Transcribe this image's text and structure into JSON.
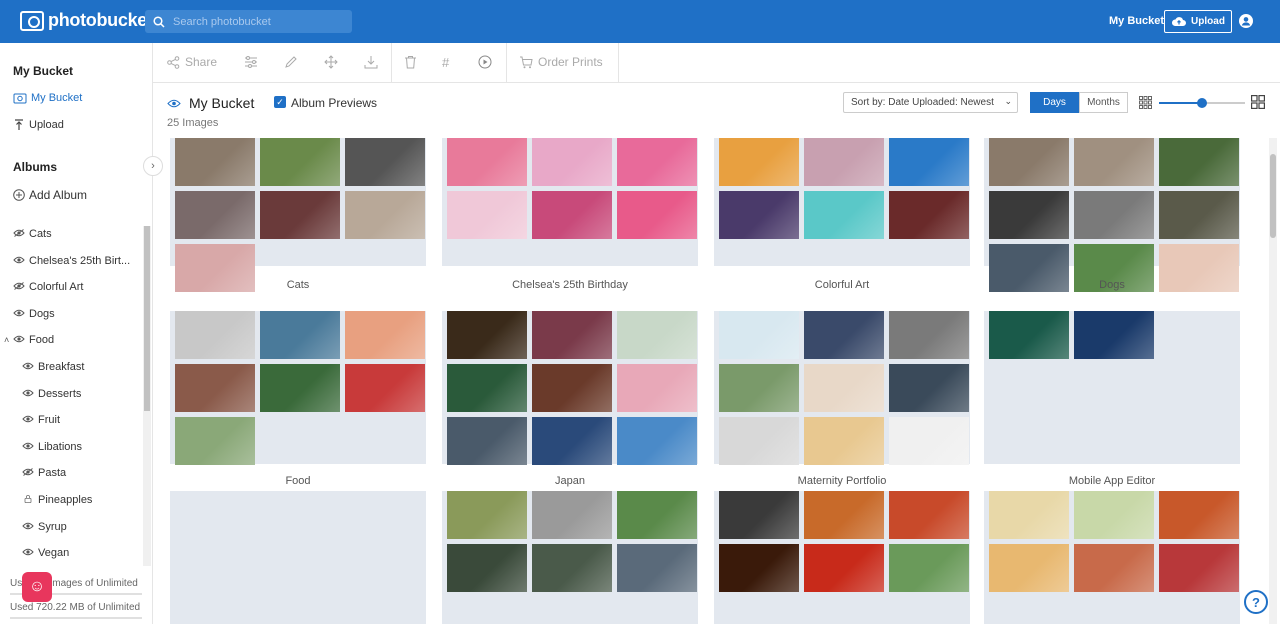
{
  "app": {
    "brand": "photobucket",
    "accent": "#1f70c6"
  },
  "topbar": {
    "search_placeholder": "Search photobucket",
    "my_bucket": "My Bucket",
    "upload": "Upload"
  },
  "sidebar": {
    "section_title": "My Bucket",
    "my_bucket": "My Bucket",
    "upload": "Upload",
    "albums_title": "Albums",
    "add_album": "Add Album",
    "albums": [
      {
        "label": "Cats",
        "icon": "eye-off-icon"
      },
      {
        "label": "Chelsea's 25th Birt...",
        "icon": "eye-icon"
      },
      {
        "label": "Colorful Art",
        "icon": "eye-off-icon"
      },
      {
        "label": "Dogs",
        "icon": "eye-icon"
      },
      {
        "label": "Food",
        "icon": "eye-icon"
      }
    ],
    "subalbums": [
      {
        "label": "Breakfast",
        "icon": "eye-icon"
      },
      {
        "label": "Desserts",
        "icon": "eye-icon"
      },
      {
        "label": "Fruit",
        "icon": "eye-icon"
      },
      {
        "label": "Libations",
        "icon": "eye-icon"
      },
      {
        "label": "Pasta",
        "icon": "eye-off-icon"
      },
      {
        "label": "Pineapples",
        "icon": "lock-icon"
      },
      {
        "label": "Syrup",
        "icon": "eye-icon"
      },
      {
        "label": "Vegan",
        "icon": "eye-icon"
      }
    ],
    "usage_images": "Used 25 images of Unlimited",
    "usage_storage": "Used 720.22 MB of Unlimited"
  },
  "toolbar": {
    "share": "Share",
    "order_prints": "Order Prints"
  },
  "header": {
    "title": "My Bucket",
    "album_previews": "Album Previews",
    "album_previews_checked": true,
    "image_count": "25 Images",
    "sort": "Sort by: Date Uploaded: Newest",
    "days": "Days",
    "months": "Months",
    "zoom_level": 0.5
  },
  "albums": [
    {
      "name": "Cats",
      "colors": [
        "#8a7a6a",
        "#6a8a4a",
        "#555555",
        "#7a6a6a",
        "#6a3a3a",
        "#b8a898",
        "#d8a8a8"
      ]
    },
    {
      "name": "Chelsea's 25th Birthday",
      "colors": [
        "#e87a9a",
        "#e8a8c8",
        "#e86a9a",
        "#f0c8d8",
        "#c84a7a",
        "#e85a8a"
      ]
    },
    {
      "name": "Colorful Art",
      "colors": [
        "#e8a040",
        "#c8a0b0",
        "#2a7ac8",
        "#4a3a6a",
        "#5ac8c8",
        "#6a2a2a"
      ]
    },
    {
      "name": "Dogs",
      "colors": [
        "#8a7a6a",
        "#a09080",
        "#4a6a3a",
        "#3a3a3a",
        "#7a7a7a",
        "#5a5a4a",
        "#4a5a6a",
        "#5a8a4a",
        "#e8c8b8"
      ]
    },
    {
      "name": "Food",
      "colors": [
        "#c8c8c8",
        "#4a7a9a",
        "#e8a080",
        "#8a5a4a",
        "#3a6a3a",
        "#c83a3a",
        "#8aa878"
      ]
    },
    {
      "name": "Japan",
      "colors": [
        "#3a2a1a",
        "#7a3a4a",
        "#c8d8c8",
        "#2a5a3a",
        "#6a3a2a",
        "#e8a8b8",
        "#4a5a6a",
        "#2a4a7a",
        "#4a8ac8"
      ]
    },
    {
      "name": "Maternity Portfolio",
      "colors": [
        "#d8e8f0",
        "#3a4a6a",
        "#7a7a7a",
        "#7a9a6a",
        "#e8d8c8",
        "#3a4a5a",
        "#d8d8d8",
        "#e8c890",
        "#f0f0f0"
      ]
    },
    {
      "name": "Mobile App Editor",
      "colors": [
        "#1a5a4a",
        "#1a3a6a"
      ]
    },
    {
      "name": "",
      "colors": []
    },
    {
      "name": "",
      "colors": [
        "#8a9a5a",
        "#9a9a9a",
        "#5a8a4a",
        "#3a4a3a",
        "#4a5a4a",
        "#5a6a7a"
      ]
    },
    {
      "name": "",
      "colors": [
        "#3a3a3a",
        "#c86a2a",
        "#c84a2a",
        "#3a1a0a",
        "#c82a1a",
        "#6a9a5a"
      ]
    },
    {
      "name": "",
      "colors": [
        "#e8d8a8",
        "#c8d8a8",
        "#c8582a",
        "#e8b870",
        "#c86a4a",
        "#b8383a"
      ]
    }
  ]
}
